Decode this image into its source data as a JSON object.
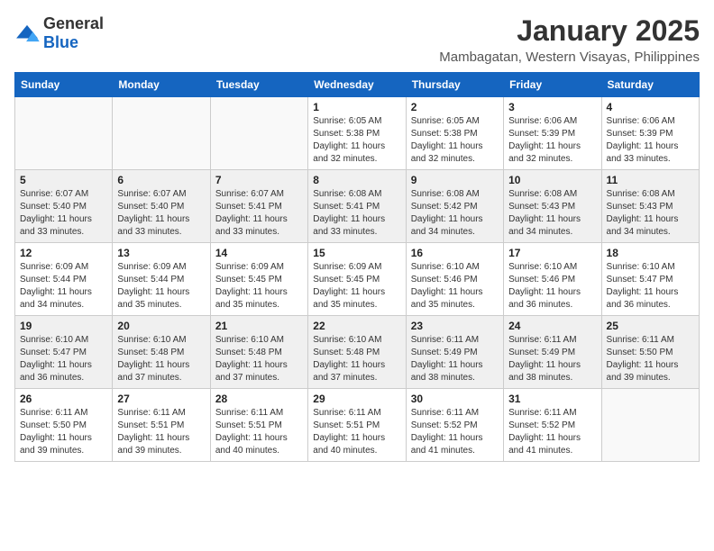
{
  "header": {
    "logo": {
      "text_general": "General",
      "text_blue": "Blue"
    },
    "month": "January 2025",
    "location": "Mambagatan, Western Visayas, Philippines"
  },
  "days_of_week": [
    "Sunday",
    "Monday",
    "Tuesday",
    "Wednesday",
    "Thursday",
    "Friday",
    "Saturday"
  ],
  "weeks": [
    [
      {
        "day": "",
        "info": ""
      },
      {
        "day": "",
        "info": ""
      },
      {
        "day": "",
        "info": ""
      },
      {
        "day": "1",
        "info": "Sunrise: 6:05 AM\nSunset: 5:38 PM\nDaylight: 11 hours\nand 32 minutes."
      },
      {
        "day": "2",
        "info": "Sunrise: 6:05 AM\nSunset: 5:38 PM\nDaylight: 11 hours\nand 32 minutes."
      },
      {
        "day": "3",
        "info": "Sunrise: 6:06 AM\nSunset: 5:39 PM\nDaylight: 11 hours\nand 32 minutes."
      },
      {
        "day": "4",
        "info": "Sunrise: 6:06 AM\nSunset: 5:39 PM\nDaylight: 11 hours\nand 33 minutes."
      }
    ],
    [
      {
        "day": "5",
        "info": "Sunrise: 6:07 AM\nSunset: 5:40 PM\nDaylight: 11 hours\nand 33 minutes."
      },
      {
        "day": "6",
        "info": "Sunrise: 6:07 AM\nSunset: 5:40 PM\nDaylight: 11 hours\nand 33 minutes."
      },
      {
        "day": "7",
        "info": "Sunrise: 6:07 AM\nSunset: 5:41 PM\nDaylight: 11 hours\nand 33 minutes."
      },
      {
        "day": "8",
        "info": "Sunrise: 6:08 AM\nSunset: 5:41 PM\nDaylight: 11 hours\nand 33 minutes."
      },
      {
        "day": "9",
        "info": "Sunrise: 6:08 AM\nSunset: 5:42 PM\nDaylight: 11 hours\nand 34 minutes."
      },
      {
        "day": "10",
        "info": "Sunrise: 6:08 AM\nSunset: 5:43 PM\nDaylight: 11 hours\nand 34 minutes."
      },
      {
        "day": "11",
        "info": "Sunrise: 6:08 AM\nSunset: 5:43 PM\nDaylight: 11 hours\nand 34 minutes."
      }
    ],
    [
      {
        "day": "12",
        "info": "Sunrise: 6:09 AM\nSunset: 5:44 PM\nDaylight: 11 hours\nand 34 minutes."
      },
      {
        "day": "13",
        "info": "Sunrise: 6:09 AM\nSunset: 5:44 PM\nDaylight: 11 hours\nand 35 minutes."
      },
      {
        "day": "14",
        "info": "Sunrise: 6:09 AM\nSunset: 5:45 PM\nDaylight: 11 hours\nand 35 minutes."
      },
      {
        "day": "15",
        "info": "Sunrise: 6:09 AM\nSunset: 5:45 PM\nDaylight: 11 hours\nand 35 minutes."
      },
      {
        "day": "16",
        "info": "Sunrise: 6:10 AM\nSunset: 5:46 PM\nDaylight: 11 hours\nand 35 minutes."
      },
      {
        "day": "17",
        "info": "Sunrise: 6:10 AM\nSunset: 5:46 PM\nDaylight: 11 hours\nand 36 minutes."
      },
      {
        "day": "18",
        "info": "Sunrise: 6:10 AM\nSunset: 5:47 PM\nDaylight: 11 hours\nand 36 minutes."
      }
    ],
    [
      {
        "day": "19",
        "info": "Sunrise: 6:10 AM\nSunset: 5:47 PM\nDaylight: 11 hours\nand 36 minutes."
      },
      {
        "day": "20",
        "info": "Sunrise: 6:10 AM\nSunset: 5:48 PM\nDaylight: 11 hours\nand 37 minutes."
      },
      {
        "day": "21",
        "info": "Sunrise: 6:10 AM\nSunset: 5:48 PM\nDaylight: 11 hours\nand 37 minutes."
      },
      {
        "day": "22",
        "info": "Sunrise: 6:10 AM\nSunset: 5:48 PM\nDaylight: 11 hours\nand 37 minutes."
      },
      {
        "day": "23",
        "info": "Sunrise: 6:11 AM\nSunset: 5:49 PM\nDaylight: 11 hours\nand 38 minutes."
      },
      {
        "day": "24",
        "info": "Sunrise: 6:11 AM\nSunset: 5:49 PM\nDaylight: 11 hours\nand 38 minutes."
      },
      {
        "day": "25",
        "info": "Sunrise: 6:11 AM\nSunset: 5:50 PM\nDaylight: 11 hours\nand 39 minutes."
      }
    ],
    [
      {
        "day": "26",
        "info": "Sunrise: 6:11 AM\nSunset: 5:50 PM\nDaylight: 11 hours\nand 39 minutes."
      },
      {
        "day": "27",
        "info": "Sunrise: 6:11 AM\nSunset: 5:51 PM\nDaylight: 11 hours\nand 39 minutes."
      },
      {
        "day": "28",
        "info": "Sunrise: 6:11 AM\nSunset: 5:51 PM\nDaylight: 11 hours\nand 40 minutes."
      },
      {
        "day": "29",
        "info": "Sunrise: 6:11 AM\nSunset: 5:51 PM\nDaylight: 11 hours\nand 40 minutes."
      },
      {
        "day": "30",
        "info": "Sunrise: 6:11 AM\nSunset: 5:52 PM\nDaylight: 11 hours\nand 41 minutes."
      },
      {
        "day": "31",
        "info": "Sunrise: 6:11 AM\nSunset: 5:52 PM\nDaylight: 11 hours\nand 41 minutes."
      },
      {
        "day": "",
        "info": ""
      }
    ]
  ]
}
